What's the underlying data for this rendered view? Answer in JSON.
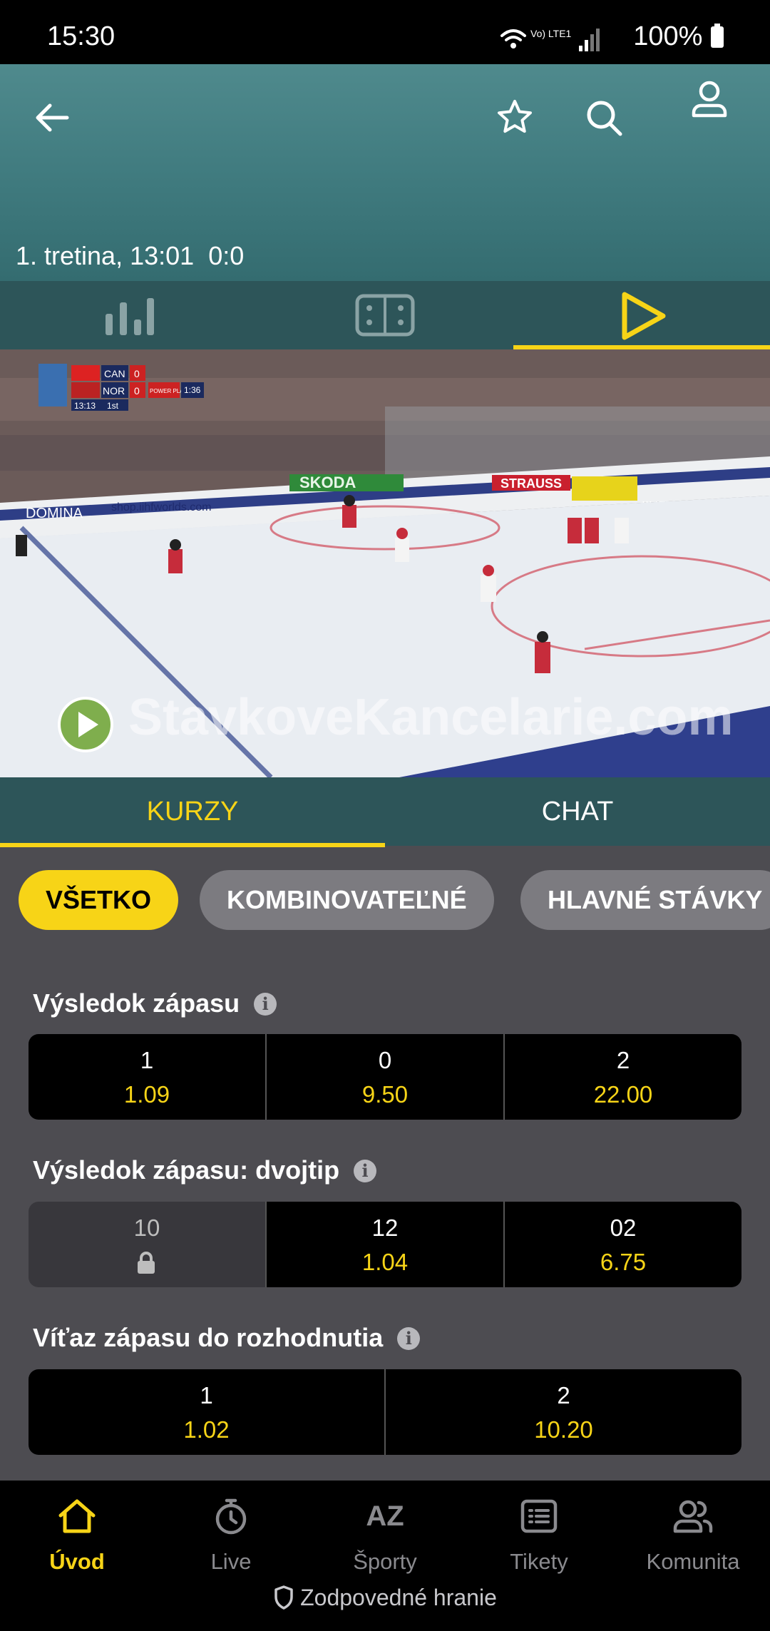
{
  "status_bar": {
    "time": "15:30",
    "battery": "100%",
    "network": "Vo) LTE1"
  },
  "header": {
    "match_status": "1. tretina, 13:01",
    "score": "0:0"
  },
  "view_tabs": [
    "stats-icon",
    "field-icon",
    "play-icon"
  ],
  "video": {
    "watermark": "StavkoveKancelarie.com",
    "scoreboard": {
      "team1": "CAN",
      "score1": "0",
      "team2": "NOR",
      "score2": "0",
      "note": "POWER PLAY",
      "clock": "13:13",
      "period": "1st",
      "pp_time": "1:36"
    },
    "ads": [
      "SKODA",
      "STRAUSS",
      "IIHFWORLDS",
      "shop.iihfworlds.com",
      "DOMINA"
    ]
  },
  "content_tabs": {
    "odds": "KURZY",
    "chat": "CHAT"
  },
  "filters": [
    "VŠETKO",
    "KOMBINOVATEĽNÉ",
    "HLAVNÉ STÁVKY"
  ],
  "markets": [
    {
      "title": "Výsledok zápasu",
      "outcomes": [
        {
          "label": "1",
          "odd": "1.09"
        },
        {
          "label": "0",
          "odd": "9.50"
        },
        {
          "label": "2",
          "odd": "22.00"
        }
      ]
    },
    {
      "title": "Výsledok zápasu: dvojtip",
      "outcomes": [
        {
          "label": "10",
          "odd": ""
        },
        {
          "label": "12",
          "odd": "1.04"
        },
        {
          "label": "02",
          "odd": "6.75"
        }
      ]
    },
    {
      "title": "Víťaz zápasu do rozhodnutia",
      "outcomes": [
        {
          "label": "1",
          "odd": "1.02"
        },
        {
          "label": "2",
          "odd": "10.20"
        }
      ]
    }
  ],
  "bottom_nav": [
    "Úvod",
    "Live",
    "Športy",
    "Tikety",
    "Komunita"
  ],
  "responsible": "Zodpovedné hranie",
  "colors": {
    "accent": "#f7d417",
    "header": "#3f7a7e",
    "tabs": "#2d5559",
    "background": "#4d4c51"
  }
}
